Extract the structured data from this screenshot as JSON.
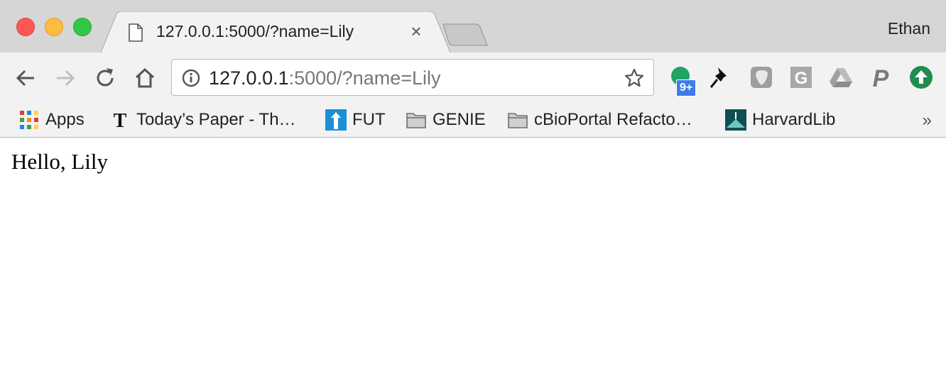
{
  "window": {
    "profile_name": "Ethan"
  },
  "tab": {
    "title": "127.0.0.1:5000/?name=Lily",
    "favicon": "page-icon",
    "close_icon": "close-icon"
  },
  "omnibox": {
    "url_host": "127.0.0.1",
    "url_path": ":5000/?name=Lily",
    "info_icon": "info-icon",
    "star_icon": "star-icon"
  },
  "extensions": {
    "badge_text": "9+"
  },
  "bookmarks": {
    "items": [
      {
        "label": "Apps",
        "icon": "apps-grid-icon"
      },
      {
        "label": "Today’s Paper - Th…",
        "icon": "nyt-icon"
      },
      {
        "label": "FUT",
        "icon": "fut-icon"
      },
      {
        "label": "GENIE",
        "icon": "folder-icon"
      },
      {
        "label": "cBioPortal Refacto…",
        "icon": "folder-icon"
      },
      {
        "label": "HarvardLib",
        "icon": "harvardlib-icon"
      }
    ],
    "overflow": "»"
  },
  "page": {
    "greeting": "Hello, Lily"
  },
  "colors": {
    "close": "#fc5753",
    "minimize": "#fdbc40",
    "maximize": "#33c748",
    "badge": "#3d7de8"
  }
}
